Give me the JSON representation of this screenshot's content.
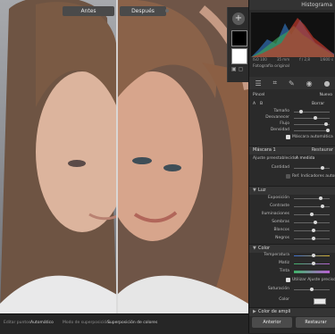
{
  "viewer": {
    "before_label": "Antes",
    "after_label": "Después"
  },
  "histogram": {
    "title": "Histograma",
    "info": [
      "ISO 100",
      "35 mm",
      "f / 2,8",
      "1/800 s"
    ],
    "original_photo": "Fotografía original"
  },
  "panel": {
    "preset_label": "Pincel",
    "new_label": "Nuevo",
    "delete_label": "Borrar",
    "brush_rows": [
      "Tamaño",
      "Desvanecer",
      "Flujo",
      "Densidad"
    ],
    "auto_mask": "Máscara automática",
    "masks_title": "Máscara 1",
    "masks_reset": "Restaurar",
    "preset_text": "Ajuste preestablecido:",
    "preset_value": "A medida",
    "amount_label": "Cantidad",
    "ref_adjust": "Ref. Indicadores auton",
    "light_section": "Luz",
    "light_rows": [
      "Exposición",
      "Contraste",
      "Iluminaciones",
      "Sombras",
      "Blancos",
      "Negros"
    ],
    "color_section": "Color",
    "color_rows": [
      "Temperatura",
      "Matiz"
    ],
    "tint_label": "Tinta",
    "use_color_fine": "Utilizar Ajuste preciso",
    "saturation": "Saturación",
    "color_label": "Color",
    "effects_section": "Color de ampli",
    "previous_button": "Anterior",
    "reset_button": "Restaurar"
  },
  "toolbar": {
    "show_label": "Editar puntos:",
    "show_value": "Automático",
    "overlay_label": "Modo de superposición:",
    "overlay_value": "Superposición de colores"
  }
}
